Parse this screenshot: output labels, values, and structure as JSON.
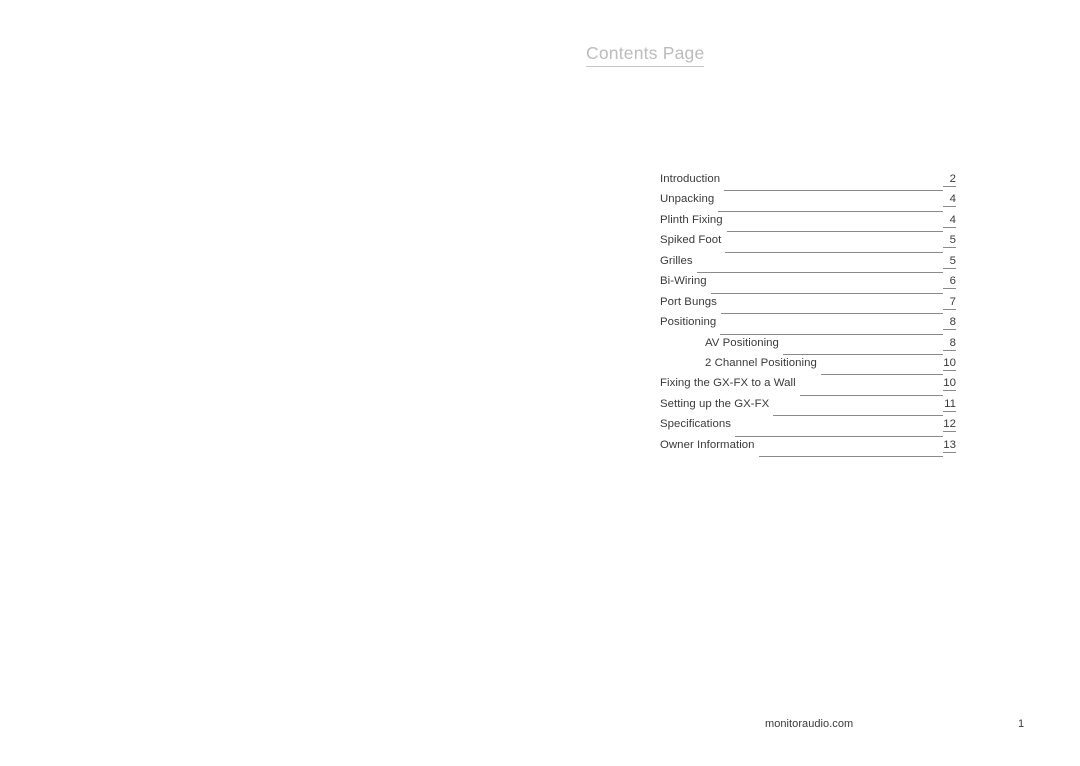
{
  "document": {
    "title": "Contents Page"
  },
  "contents": {
    "entries": [
      {
        "label": "Introduction",
        "page": "2",
        "level": 0
      },
      {
        "label": "Unpacking",
        "page": "4",
        "level": 0
      },
      {
        "label": "Plinth Fixing",
        "page": "4",
        "level": 0
      },
      {
        "label": "Spiked Foot",
        "page": "5",
        "level": 0
      },
      {
        "label": "Grilles",
        "page": "5",
        "level": 0
      },
      {
        "label": "Bi-Wiring",
        "page": "6",
        "level": 0
      },
      {
        "label": "Port Bungs",
        "page": "7",
        "level": 0
      },
      {
        "label": "Positioning",
        "page": "8",
        "level": 0
      },
      {
        "label": "AV Positioning",
        "page": "8",
        "level": 1
      },
      {
        "label": "2 Channel Positioning",
        "page": "10",
        "level": 1
      },
      {
        "label": "Fixing the GX-FX to a Wall",
        "page": "10",
        "level": 0
      },
      {
        "label": "Setting up the GX-FX",
        "page": "11",
        "level": 0
      },
      {
        "label": "Specifications",
        "page": "12",
        "level": 0
      },
      {
        "label": "Owner Information",
        "page": "13",
        "level": 0
      }
    ]
  },
  "footer": {
    "website": "monitoraudio.com",
    "page_number": "1"
  },
  "colors": {
    "title": "#bcbcbc",
    "body_text": "#3a3a3a",
    "leader_line": "#8a8a8a",
    "background": "#ffffff"
  }
}
